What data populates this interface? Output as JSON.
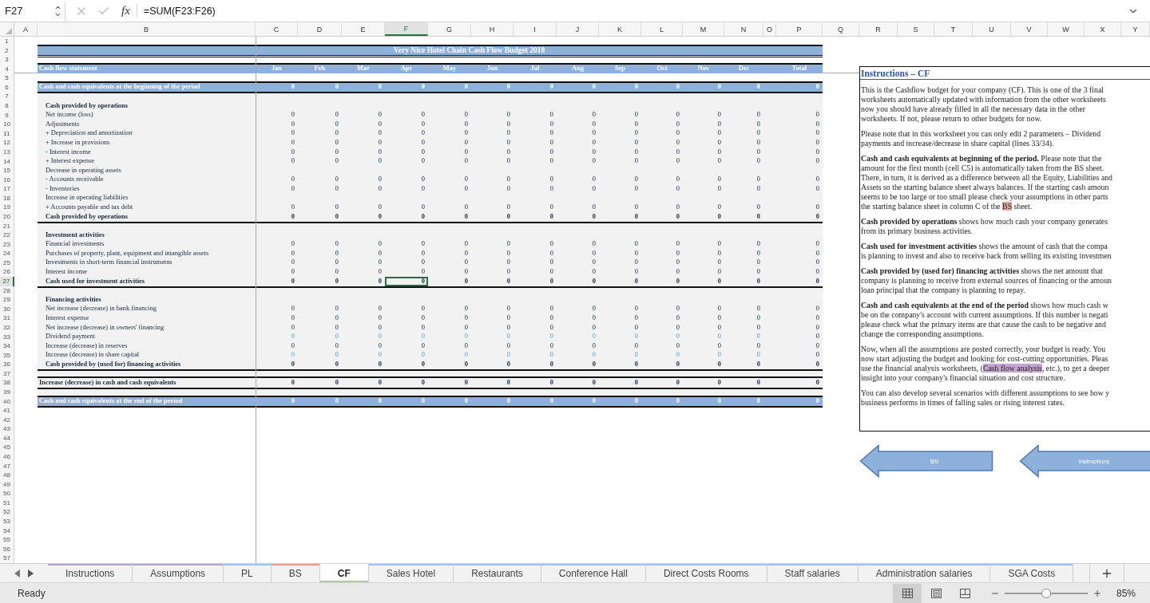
{
  "formula_bar": {
    "name_box": "F27",
    "function_label": "fx",
    "formula": "=SUM(F23:F26)"
  },
  "column_headers": [
    {
      "label": "A",
      "selected": false
    },
    {
      "label": "B",
      "selected": false
    },
    {
      "label": "C",
      "selected": false
    },
    {
      "label": "D",
      "selected": false
    },
    {
      "label": "E",
      "selected": false
    },
    {
      "label": "F",
      "selected": true
    },
    {
      "label": "G",
      "selected": false
    },
    {
      "label": "H",
      "selected": false
    },
    {
      "label": "I",
      "selected": false
    },
    {
      "label": "J",
      "selected": false
    },
    {
      "label": "K",
      "selected": false
    },
    {
      "label": "L",
      "selected": false
    },
    {
      "label": "M",
      "selected": false
    },
    {
      "label": "N",
      "selected": false
    },
    {
      "label": "O",
      "selected": false
    },
    {
      "label": "P",
      "selected": false
    },
    {
      "label": "Q",
      "selected": false
    },
    {
      "label": "R",
      "selected": false
    },
    {
      "label": "S",
      "selected": false
    },
    {
      "label": "T",
      "selected": false
    },
    {
      "label": "U",
      "selected": false
    },
    {
      "label": "V",
      "selected": false
    },
    {
      "label": "W",
      "selected": false
    },
    {
      "label": "X",
      "selected": false
    },
    {
      "label": "Y",
      "selected": false
    }
  ],
  "row_headers": [
    {
      "label": "1",
      "selected": false
    },
    {
      "label": "2",
      "selected": false
    },
    {
      "label": "3",
      "selected": false
    },
    {
      "label": "4",
      "selected": false
    },
    {
      "label": "5",
      "selected": false
    },
    {
      "label": "6",
      "selected": false
    },
    {
      "label": "7",
      "selected": false
    },
    {
      "label": "8",
      "selected": false
    },
    {
      "label": "9",
      "selected": false
    },
    {
      "label": "10",
      "selected": false
    },
    {
      "label": "11",
      "selected": false
    },
    {
      "label": "12",
      "selected": false
    },
    {
      "label": "13",
      "selected": false
    },
    {
      "label": "14",
      "selected": false
    },
    {
      "label": "15",
      "selected": false
    },
    {
      "label": "16",
      "selected": false
    },
    {
      "label": "17",
      "selected": false
    },
    {
      "label": "18",
      "selected": false
    },
    {
      "label": "19",
      "selected": false
    },
    {
      "label": "20",
      "selected": false
    },
    {
      "label": "21",
      "selected": false
    },
    {
      "label": "22",
      "selected": false
    },
    {
      "label": "23",
      "selected": false
    },
    {
      "label": "24",
      "selected": false
    },
    {
      "label": "25",
      "selected": false
    },
    {
      "label": "26",
      "selected": false
    },
    {
      "label": "27",
      "selected": true
    },
    {
      "label": "28",
      "selected": false
    },
    {
      "label": "29",
      "selected": false
    },
    {
      "label": "30",
      "selected": false
    },
    {
      "label": "31",
      "selected": false
    },
    {
      "label": "32",
      "selected": false
    },
    {
      "label": "33",
      "selected": false
    },
    {
      "label": "34",
      "selected": false
    },
    {
      "label": "35",
      "selected": false
    },
    {
      "label": "36",
      "selected": false
    },
    {
      "label": "37",
      "selected": false
    },
    {
      "label": "38",
      "selected": false
    },
    {
      "label": "39",
      "selected": false
    },
    {
      "label": "40",
      "selected": false
    },
    {
      "label": "41",
      "selected": false
    },
    {
      "label": "42",
      "selected": false
    },
    {
      "label": "43",
      "selected": false
    },
    {
      "label": "44",
      "selected": false
    },
    {
      "label": "45",
      "selected": false
    },
    {
      "label": "46",
      "selected": false
    },
    {
      "label": "47",
      "selected": false
    },
    {
      "label": "48",
      "selected": false
    },
    {
      "label": "49",
      "selected": false
    },
    {
      "label": "50",
      "selected": false
    },
    {
      "label": "51",
      "selected": false
    },
    {
      "label": "52",
      "selected": false
    },
    {
      "label": "53",
      "selected": false
    },
    {
      "label": "54",
      "selected": false
    },
    {
      "label": "55",
      "selected": false
    },
    {
      "label": "56",
      "selected": false
    },
    {
      "label": "57",
      "selected": false
    }
  ],
  "table": {
    "title": "Very Nice Hotel Chain Cash Flow Budget 2018",
    "header_label": "Cash flow statement",
    "columns": [
      "Jan",
      "Feb",
      "Mar",
      "Apr",
      "May",
      "Jun",
      "Jul",
      "Aug",
      "Sep",
      "Oct",
      "Nov",
      "Dec",
      "Total"
    ],
    "lines": [
      {
        "kind": "blank"
      },
      {
        "kind": "band",
        "label": "Cash and cash equivalents at the beginning of the period",
        "values": [
          "0",
          "0",
          "0",
          "0",
          "0",
          "0",
          "0",
          "0",
          "0",
          "0",
          "0",
          "0",
          "0"
        ]
      },
      {
        "kind": "blank"
      },
      {
        "kind": "heading",
        "label": "Cash provided by operations"
      },
      {
        "kind": "item",
        "label": "Net income (loss)",
        "editable": false,
        "values": [
          "0",
          "0",
          "0",
          "0",
          "0",
          "0",
          "0",
          "0",
          "0",
          "0",
          "0",
          "0",
          "0"
        ]
      },
      {
        "kind": "item",
        "label": "Adjustments",
        "editable": false,
        "values": [
          "0",
          "0",
          "0",
          "0",
          "0",
          "0",
          "0",
          "0",
          "0",
          "0",
          "0",
          "0",
          "0"
        ]
      },
      {
        "kind": "item",
        "label": "+ Depreciation and amortization",
        "editable": false,
        "values": [
          "0",
          "0",
          "0",
          "0",
          "0",
          "0",
          "0",
          "0",
          "0",
          "0",
          "0",
          "0",
          "0"
        ]
      },
      {
        "kind": "item",
        "label": "+ Increase in provisions",
        "editable": false,
        "values": [
          "0",
          "0",
          "0",
          "0",
          "0",
          "0",
          "0",
          "0",
          "0",
          "0",
          "0",
          "0",
          "0"
        ]
      },
      {
        "kind": "item",
        "label": "- Interest income",
        "editable": false,
        "values": [
          "0",
          "0",
          "0",
          "0",
          "0",
          "0",
          "0",
          "0",
          "0",
          "0",
          "0",
          "0",
          "0"
        ]
      },
      {
        "kind": "item",
        "label": "+ Interest expense",
        "editable": false,
        "values": [
          "0",
          "0",
          "0",
          "0",
          "0",
          "0",
          "0",
          "0",
          "0",
          "0",
          "0",
          "0",
          "0"
        ]
      },
      {
        "kind": "label",
        "label": "Decrease in operating assets"
      },
      {
        "kind": "item",
        "label": "- Accounts receivable",
        "editable": false,
        "values": [
          "0",
          "0",
          "0",
          "0",
          "0",
          "0",
          "0",
          "0",
          "0",
          "0",
          "0",
          "0",
          "0"
        ]
      },
      {
        "kind": "item",
        "label": "- Inventories",
        "editable": false,
        "values": [
          "0",
          "0",
          "0",
          "0",
          "0",
          "0",
          "0",
          "0",
          "0",
          "0",
          "0",
          "0",
          "0"
        ]
      },
      {
        "kind": "label",
        "label": "Increase in operating liabilities"
      },
      {
        "kind": "item",
        "label": "+ Accounts payable and tax debt",
        "editable": false,
        "values": [
          "0",
          "0",
          "0",
          "0",
          "0",
          "0",
          "0",
          "0",
          "0",
          "0",
          "0",
          "0",
          "0"
        ]
      },
      {
        "kind": "total",
        "label": "Cash provided by operations",
        "values": [
          "0",
          "0",
          "0",
          "0",
          "0",
          "0",
          "0",
          "0",
          "0",
          "0",
          "0",
          "0",
          "0"
        ]
      },
      {
        "kind": "blank"
      },
      {
        "kind": "heading",
        "label": "Investment activities"
      },
      {
        "kind": "item",
        "label": "Financial investments",
        "editable": false,
        "values": [
          "0",
          "0",
          "0",
          "0",
          "0",
          "0",
          "0",
          "0",
          "0",
          "0",
          "0",
          "0",
          "0"
        ]
      },
      {
        "kind": "item",
        "label": "Purchases of property, plant, equipment and intangible assets",
        "editable": false,
        "values": [
          "0",
          "0",
          "0",
          "0",
          "0",
          "0",
          "0",
          "0",
          "0",
          "0",
          "0",
          "0",
          "0"
        ]
      },
      {
        "kind": "item",
        "label": "Investments in short-term financial instrumetns",
        "editable": false,
        "values": [
          "0",
          "0",
          "0",
          "0",
          "0",
          "0",
          "0",
          "0",
          "0",
          "0",
          "0",
          "0",
          "0"
        ]
      },
      {
        "kind": "item",
        "label": "Interest income",
        "editable": false,
        "values": [
          "0",
          "0",
          "0",
          "0",
          "0",
          "0",
          "0",
          "0",
          "0",
          "0",
          "0",
          "0",
          "0"
        ]
      },
      {
        "kind": "total",
        "label": "Cash used for investment activities",
        "values": [
          "0",
          "0",
          "0",
          "0",
          "0",
          "0",
          "0",
          "0",
          "0",
          "0",
          "0",
          "0",
          "0"
        ]
      },
      {
        "kind": "blank"
      },
      {
        "kind": "heading",
        "label": "Financing activities"
      },
      {
        "kind": "item",
        "label": "Net increase (decrease) in bank financing",
        "editable": false,
        "values": [
          "0",
          "0",
          "0",
          "0",
          "0",
          "0",
          "0",
          "0",
          "0",
          "0",
          "0",
          "0",
          "0"
        ]
      },
      {
        "kind": "item",
        "label": "Interest expense",
        "editable": false,
        "values": [
          "0",
          "0",
          "0",
          "0",
          "0",
          "0",
          "0",
          "0",
          "0",
          "0",
          "0",
          "0",
          "0"
        ]
      },
      {
        "kind": "item",
        "label": "Net increase (decrease) in owners' financing",
        "editable": false,
        "values": [
          "0",
          "0",
          "0",
          "0",
          "0",
          "0",
          "0",
          "0",
          "0",
          "0",
          "0",
          "0",
          "0"
        ]
      },
      {
        "kind": "item",
        "label": "Dividend payment",
        "editable": true,
        "values": [
          "0",
          "0",
          "0",
          "0",
          "0",
          "0",
          "0",
          "0",
          "0",
          "0",
          "0",
          "0",
          "0"
        ]
      },
      {
        "kind": "item",
        "label": "Increase (decrease) in reserves",
        "editable": false,
        "values": [
          "0",
          "0",
          "0",
          "0",
          "0",
          "0",
          "0",
          "0",
          "0",
          "0",
          "0",
          "0",
          "0"
        ]
      },
      {
        "kind": "item",
        "label": "Increase (decrease) in share capital",
        "editable": true,
        "values": [
          "0",
          "0",
          "0",
          "0",
          "0",
          "0",
          "0",
          "0",
          "0",
          "0",
          "0",
          "0",
          "0"
        ]
      },
      {
        "kind": "total",
        "label": "Cash provided by (used for) financing activities",
        "values": [
          "0",
          "0",
          "0",
          "0",
          "0",
          "0",
          "0",
          "0",
          "0",
          "0",
          "0",
          "0",
          "0"
        ]
      },
      {
        "kind": "blank"
      },
      {
        "kind": "summary",
        "label": "Increase (decrease) in cash and cash equivalents",
        "values": [
          "0",
          "0",
          "0",
          "0",
          "0",
          "0",
          "0",
          "0",
          "0",
          "0",
          "0",
          "0",
          "0"
        ]
      },
      {
        "kind": "blank"
      },
      {
        "kind": "band",
        "label": "Cash and cash equivalents at the end of the period",
        "values": [
          "0",
          "0",
          "0",
          "0",
          "0",
          "0",
          "0",
          "0",
          "0",
          "0",
          "0",
          "0",
          "0"
        ]
      }
    ]
  },
  "instructions": {
    "title": "Instructions – CF",
    "paragraphs": [
      {
        "lines": [
          [
            {
              "kind": "plain",
              "text": "This is the Cashflow budget for your company (CF). This is one of the 3 final"
            }
          ],
          [
            {
              "kind": "plain",
              "text": "worksheets automatically updated with information from the other worksheets"
            }
          ],
          [
            {
              "kind": "plain",
              "text": "now you should have already filled in all the necessary data in the other"
            }
          ],
          [
            {
              "kind": "plain",
              "text": "worksheets. If not, please return to other budgets for now."
            }
          ]
        ]
      },
      {
        "lines": [
          [
            {
              "kind": "plain",
              "text": "Please note that in this worksheet you can only edit 2 parameters – Dividend"
            }
          ],
          [
            {
              "kind": "plain",
              "text": "payments and increase/decrease in share capital (lines 33/34)."
            }
          ]
        ]
      },
      {
        "lines": [
          [
            {
              "kind": "bold",
              "text": "Cash and cash equivalents at beginning of the period."
            },
            {
              "kind": "plain",
              "text": " Please note that the"
            }
          ],
          [
            {
              "kind": "plain",
              "text": "amount for the first month (cell C5) is automatically taken from the BS sheet."
            }
          ],
          [
            {
              "kind": "plain",
              "text": "There, in turn, it is derived as a difference between all the Equity, Liabilities and"
            }
          ],
          [
            {
              "kind": "plain",
              "text": "Assets so the starting balance sheet always balances. If the starting cash amoun"
            }
          ],
          [
            {
              "kind": "plain",
              "text": "seems to be too large or too small please check your assumptions in other parts"
            }
          ],
          [
            {
              "kind": "plain",
              "text": "the starting balance sheet in column C of the "
            },
            {
              "kind": "link",
              "text": "BS",
              "color": "#e8a3a3"
            },
            {
              "kind": "plain",
              "text": " sheet."
            }
          ]
        ]
      },
      {
        "lines": [
          [
            {
              "kind": "bold",
              "text": "Cash provided by operations"
            },
            {
              "kind": "plain",
              "text": " shows how much cash your company generates"
            }
          ],
          [
            {
              "kind": "plain",
              "text": "from its primary business activities."
            }
          ]
        ]
      },
      {
        "lines": [
          [
            {
              "kind": "bold",
              "text": "Cash used for investment activities"
            },
            {
              "kind": "plain",
              "text": " shows the amount of cash that the compa"
            }
          ],
          [
            {
              "kind": "plain",
              "text": "is planning to invest and also to receive back from selling its existing investmen"
            }
          ]
        ]
      },
      {
        "lines": [
          [
            {
              "kind": "bold",
              "text": "Cash provided by (used for) financing activities"
            },
            {
              "kind": "plain",
              "text": " shows the net amount that"
            }
          ],
          [
            {
              "kind": "plain",
              "text": "company is planning to receive from external sources of financing or the amoun"
            }
          ],
          [
            {
              "kind": "plain",
              "text": "loan principal that the company is planning to repay."
            }
          ]
        ]
      },
      {
        "lines": [
          [
            {
              "kind": "bold",
              "text": "Cash and cash equivalents at the end of the period"
            },
            {
              "kind": "plain",
              "text": " shows how much cash w"
            }
          ],
          [
            {
              "kind": "plain",
              "text": "be on the company's account with current assumptions. If this number is negati"
            }
          ],
          [
            {
              "kind": "plain",
              "text": "please check what the primary items are that cause the cash to be negative and"
            }
          ],
          [
            {
              "kind": "plain",
              "text": "change the corresponding assumptions."
            }
          ]
        ]
      },
      {
        "lines": [
          [
            {
              "kind": "plain",
              "text": "Now, when all the assumptions are posted correctly, your budget is ready. You"
            }
          ],
          [
            {
              "kind": "plain",
              "text": "now start adjusting the budget and looking for cost-cutting opportunities. Pleas"
            }
          ],
          [
            {
              "kind": "plain",
              "text": "use the financial analysis worksheets, ("
            },
            {
              "kind": "link",
              "text": "Cash flow analysis",
              "color": "#c3a5d1"
            },
            {
              "kind": "plain",
              "text": ", etc.), to get a deeper"
            }
          ],
          [
            {
              "kind": "plain",
              "text": "insight into your company's financial situation and cost structure."
            }
          ]
        ]
      },
      {
        "lines": [
          [
            {
              "kind": "plain",
              "text": "You can also develop several scenarios with different assumptions to see how y"
            }
          ],
          [
            {
              "kind": "plain",
              "text": "business performs in times of falling sales or rising interest rates."
            }
          ]
        ]
      }
    ]
  },
  "arrow_buttons": [
    "BS",
    "Instructions"
  ],
  "tabs": [
    {
      "label": "Instructions",
      "selected": false,
      "color": "#b4a7d6"
    },
    {
      "label": "Assumptions",
      "selected": false,
      "color": "#b4a7d6"
    },
    {
      "label": "PL",
      "selected": false,
      "color": "#9fc5e8"
    },
    {
      "label": "BS",
      "selected": false,
      "color": "#ea9999"
    },
    {
      "label": "CF",
      "selected": true,
      "color": "#a9d08e"
    },
    {
      "label": "Sales Hotel",
      "selected": false,
      "color": "#9fc5e8"
    },
    {
      "label": "Restaurants",
      "selected": false,
      "color": "#9fc5e8"
    },
    {
      "label": "Conference Hall",
      "selected": false,
      "color": "#9fc5e8"
    },
    {
      "label": "Direct Costs Rooms",
      "selected": false,
      "color": "#9fc5e8"
    },
    {
      "label": "Staff salaries",
      "selected": false,
      "color": "#9fc5e8"
    },
    {
      "label": "Administration salaries",
      "selected": false,
      "color": "#9fc5e8"
    },
    {
      "label": "SGA Costs",
      "selected": false,
      "color": "#9fc5e8"
    }
  ],
  "status_bar": {
    "status": "Ready",
    "view_modes": [
      {
        "kind": "normal",
        "selected": true
      },
      {
        "kind": "page_layout",
        "selected": false
      },
      {
        "kind": "page_break",
        "selected": false
      }
    ],
    "zoom": {
      "level": 0.5,
      "label": "85%"
    }
  }
}
